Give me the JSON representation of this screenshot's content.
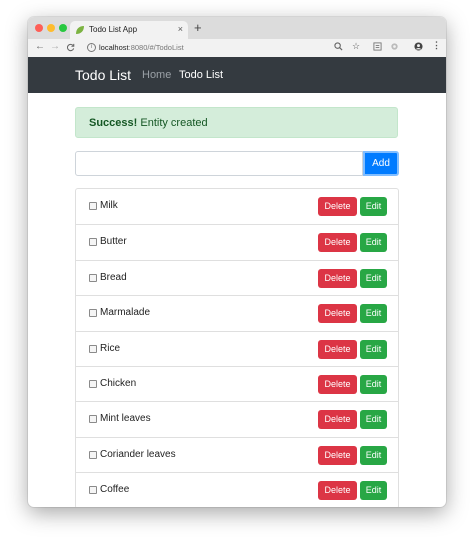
{
  "browser": {
    "tab_title": "Todo List App",
    "tab_close": "×",
    "new_tab": "+",
    "url_host": "localhost",
    "url_rest": ":8080/#/TodoList",
    "back": "←",
    "forward": "→",
    "reload": "C",
    "icons": [
      "zoom-icon",
      "star-icon",
      "extension-icon",
      "profile-icon",
      "menu-icon"
    ]
  },
  "navbar": {
    "brand": "Todo List",
    "links": [
      {
        "label": "Home",
        "active": false
      },
      {
        "label": "Todo List",
        "active": true
      }
    ]
  },
  "alert": {
    "strong": "Success!",
    "message": " Entity created"
  },
  "form": {
    "input_value": "",
    "add_label": "Add"
  },
  "todos": [
    {
      "label": "Milk",
      "checked": false
    },
    {
      "label": "Butter",
      "checked": false
    },
    {
      "label": "Bread",
      "checked": false
    },
    {
      "label": "Marmalade",
      "checked": false
    },
    {
      "label": "Rice",
      "checked": false
    },
    {
      "label": "Chicken",
      "checked": false
    },
    {
      "label": "Mint leaves",
      "checked": false
    },
    {
      "label": "Coriander leaves",
      "checked": false
    },
    {
      "label": "Coffee",
      "checked": false
    }
  ],
  "actions": {
    "delete_label": "Delete",
    "edit_label": "Edit"
  },
  "colors": {
    "navbar": "#343a40",
    "alert_bg": "#d4edda",
    "alert_text": "#155724",
    "primary": "#007bff",
    "danger": "#dc3545",
    "success": "#28a745"
  }
}
